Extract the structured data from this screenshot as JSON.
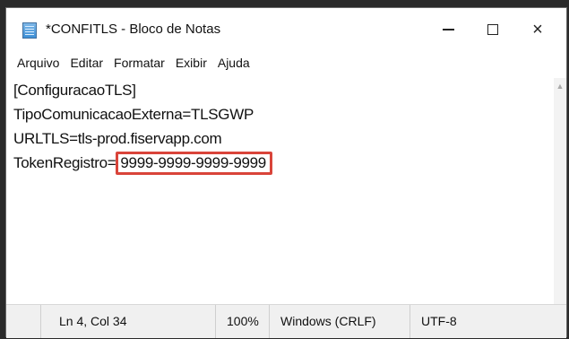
{
  "window": {
    "title": "*CONFITLS - Bloco de Notas",
    "icon": "notepad-icon",
    "controls": {
      "minimize": "minimize-icon",
      "maximize": "maximize-icon",
      "close": "×"
    }
  },
  "menu": {
    "items": [
      "Arquivo",
      "Editar",
      "Formatar",
      "Exibir",
      "Ajuda"
    ]
  },
  "editor": {
    "lines": [
      "[ConfiguracaoTLS]",
      "TipoComunicacaoExterna=TLSGWP",
      "URLTLS=tls-prod.fiservapp.com",
      "TokenRegistro="
    ],
    "highlighted_token": "9999-9999-9999-9999",
    "highlight_color": "#d9443a"
  },
  "status": {
    "position": "Ln 4, Col 34",
    "zoom": "100%",
    "line_ending": "Windows (CRLF)",
    "encoding": "UTF-8"
  }
}
